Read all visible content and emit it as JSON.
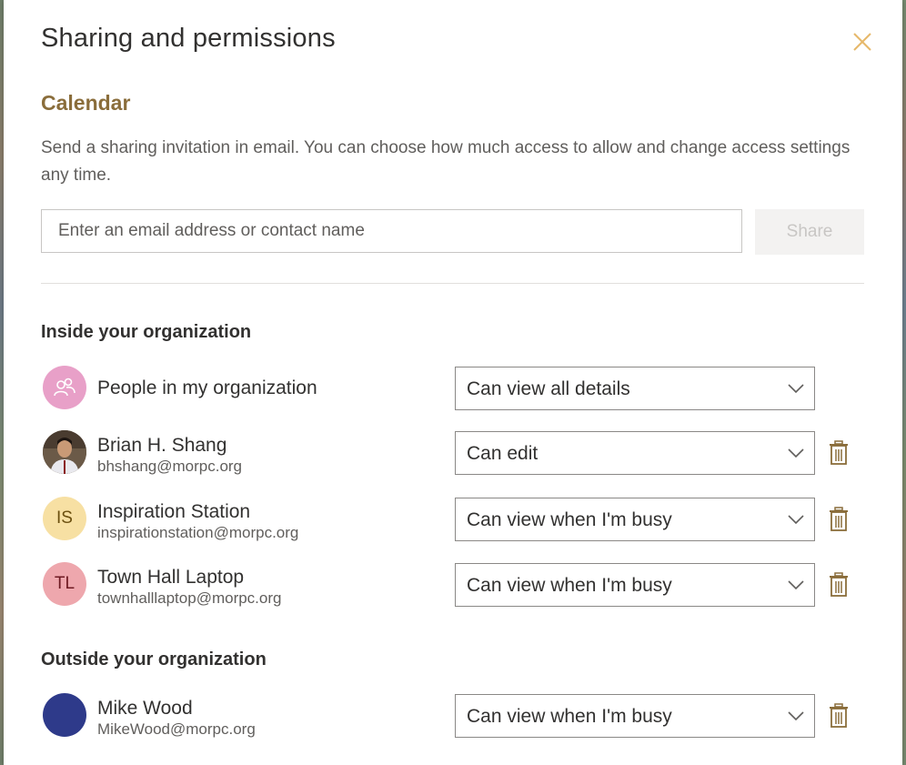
{
  "dialog": {
    "title": "Sharing and permissions",
    "calendar_name": "Calendar",
    "description": "Send a sharing invitation in email. You can choose how much access to allow and change access settings any time.",
    "email_placeholder": "Enter an email address or contact name",
    "share_label": "Share"
  },
  "sections": {
    "inside_title": "Inside your organization",
    "outside_title": "Outside your organization"
  },
  "inside": [
    {
      "name": "People in my organization",
      "permission": "Can view all details",
      "avatar_icon": "people-icon",
      "avatar_color": "#e8a0c8"
    },
    {
      "name": "Brian H. Shang",
      "email": "bhshang@morpc.org",
      "permission": "Can edit",
      "avatar_icon": "profile-photo"
    },
    {
      "name": "Inspiration Station",
      "email": "inspirationstation@morpc.org",
      "permission": "Can view when I'm busy",
      "initials": "IS",
      "avatar_color": "#f7e0a3"
    },
    {
      "name": "Town Hall Laptop",
      "email": "townhalllaptop@morpc.org",
      "permission": "Can view when I'm busy",
      "initials": "TL",
      "avatar_color": "#eea7ad"
    }
  ],
  "outside": [
    {
      "name": "Mike Wood",
      "email": "MikeWood@morpc.org",
      "permission": "Can view when I'm busy",
      "avatar_color": "#2e3a8a"
    }
  ],
  "colors": {
    "accent_gold": "#8a6d3b",
    "close_icon": "#e6b86a",
    "trash_icon": "#8a6d3b"
  }
}
